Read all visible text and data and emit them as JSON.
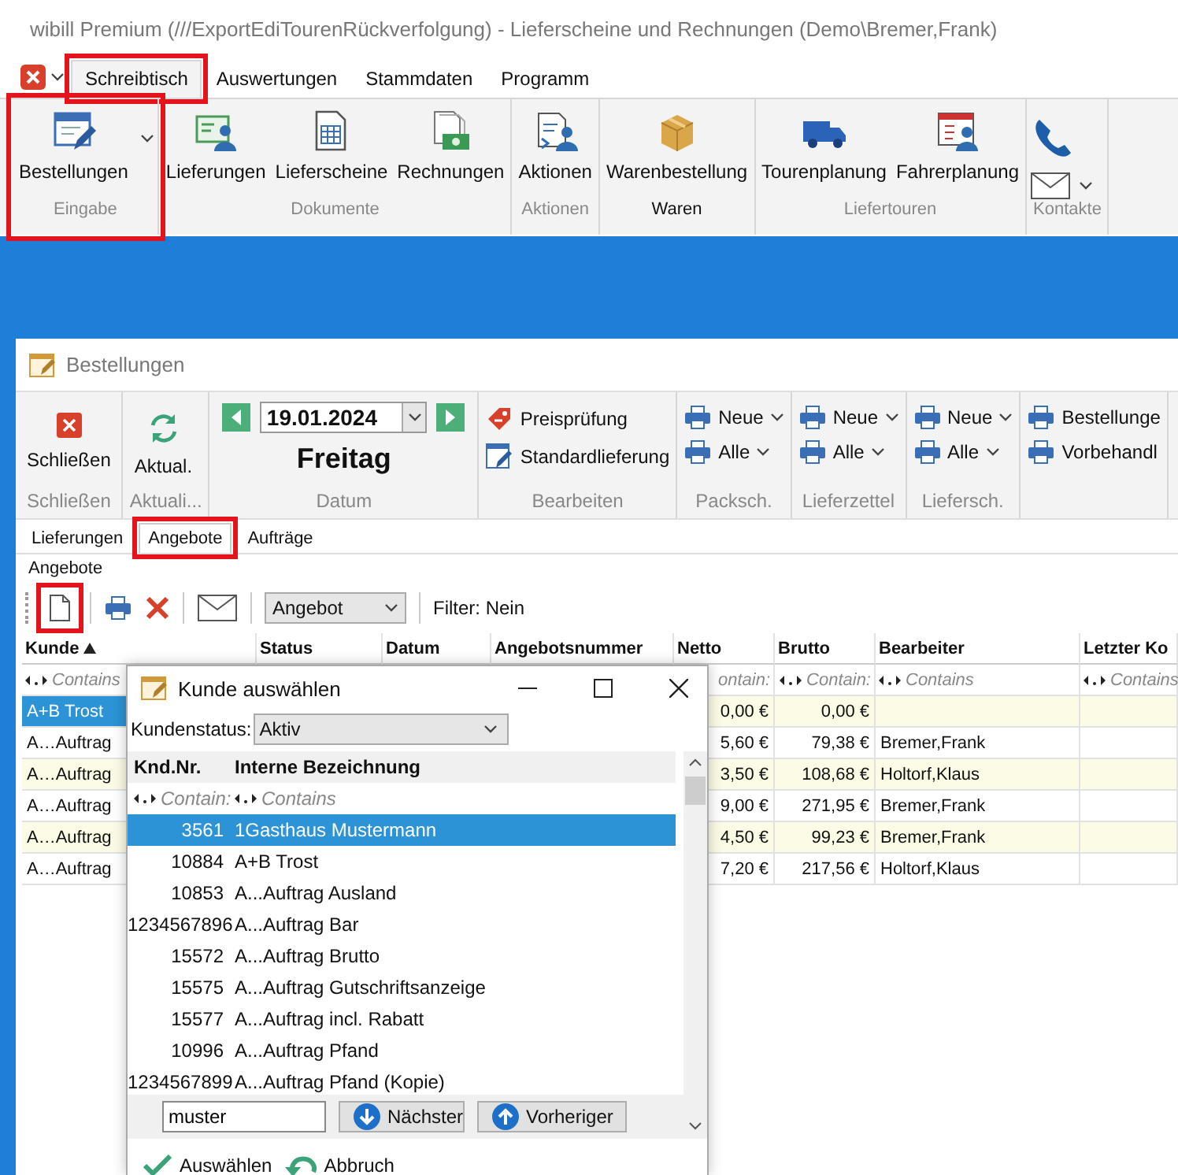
{
  "main_window": {
    "title": "wibill Premium (///ExportEdiTourenRückverfolgung) - Lieferscheine und Rechnungen (Demo\\Bremer,Frank)",
    "menu_tabs": [
      {
        "label": "Schreibtisch",
        "selected": true,
        "highlighted": true
      },
      {
        "label": "Auswertungen",
        "selected": false,
        "highlighted": false
      },
      {
        "label": "Stammdaten",
        "selected": false,
        "highlighted": false
      },
      {
        "label": "Programm",
        "selected": false,
        "highlighted": false
      }
    ],
    "ribbon_groups": [
      {
        "kind": "large",
        "label": "Eingabe",
        "highlighted": true,
        "active": false,
        "buttons": [
          {
            "label": "Bestellungen",
            "dropdown": true
          }
        ]
      },
      {
        "kind": "large",
        "label": "Dokumente",
        "highlighted": false,
        "active": false,
        "buttons": [
          {
            "label": "Lieferungen",
            "dropdown": false
          },
          {
            "label": "Lieferscheine",
            "dropdown": false
          },
          {
            "label": "Rechnungen",
            "dropdown": false
          }
        ]
      },
      {
        "kind": "large",
        "label": "Aktionen",
        "highlighted": false,
        "active": false,
        "buttons": [
          {
            "label": "Aktionen",
            "dropdown": false
          }
        ]
      },
      {
        "kind": "large",
        "label": "Waren",
        "highlighted": false,
        "active": true,
        "buttons": [
          {
            "label": "Warenbestellung",
            "dropdown": false
          }
        ]
      },
      {
        "kind": "large",
        "label": "Liefertouren",
        "highlighted": false,
        "active": false,
        "buttons": [
          {
            "label": "Tourenplanung",
            "dropdown": false
          },
          {
            "label": "Fahrerplanung",
            "dropdown": false
          }
        ]
      },
      {
        "kind": "contacts",
        "label": "Kontakte",
        "highlighted": false,
        "active": false
      }
    ]
  },
  "order_window": {
    "title": "Bestellungen",
    "ribbon_groups": [
      {
        "kind": "large",
        "label": "Schließen",
        "buttons": [
          {
            "label": "Schließen"
          }
        ]
      },
      {
        "kind": "large",
        "label": "Aktuali...",
        "buttons": [
          {
            "label": "Aktual."
          }
        ]
      },
      {
        "kind": "date",
        "label": "Datum",
        "date": "19.01.2024",
        "weekday": "Freitag"
      },
      {
        "kind": "small",
        "label": "Bearbeiten",
        "buttons": [
          {
            "label": "Preisprüfung",
            "dropdown": false
          },
          {
            "label": "Standardlieferung",
            "dropdown": false
          }
        ]
      },
      {
        "kind": "small",
        "label": "Packsch.",
        "buttons": [
          {
            "label": "Neue",
            "dropdown": true
          },
          {
            "label": "Alle",
            "dropdown": true
          }
        ]
      },
      {
        "kind": "small",
        "label": "Lieferzettel",
        "buttons": [
          {
            "label": "Neue",
            "dropdown": true
          },
          {
            "label": "Alle",
            "dropdown": true
          }
        ]
      },
      {
        "kind": "small",
        "label": "Liefersch.",
        "buttons": [
          {
            "label": "Neue",
            "dropdown": true
          },
          {
            "label": "Alle",
            "dropdown": true
          }
        ]
      },
      {
        "kind": "small",
        "buttons": [
          {
            "label": "Bestellunge",
            "dropdown": false
          },
          {
            "label": "Vorbehandl",
            "dropdown": false
          }
        ]
      }
    ],
    "tabs": [
      {
        "label": "Lieferungen",
        "selected": false,
        "highlighted": false
      },
      {
        "label": "Angebote",
        "selected": true,
        "highlighted": true
      },
      {
        "label": "Aufträge",
        "selected": false,
        "highlighted": false
      }
    ],
    "section_label": "Angebote",
    "toolbar": {
      "new_highlighted": true,
      "document_type": "Angebot",
      "filter": "Filter: Nein"
    },
    "grid": {
      "columns": [
        {
          "label": "Kunde",
          "sorted": true
        },
        {
          "label": "Status",
          "sorted": false
        },
        {
          "label": "Datum",
          "sorted": false
        },
        {
          "label": "Angebotsnummer",
          "sorted": false
        },
        {
          "label": "Netto",
          "sorted": false
        },
        {
          "label": "Brutto",
          "sorted": false
        },
        {
          "label": "Bearbeiter",
          "sorted": false
        },
        {
          "label": "Letzter Ko",
          "sorted": false
        }
      ],
      "filter_row": {
        "kunde": {
          "text": "Contains",
          "operator_icon": true
        },
        "netto": {
          "text": "ontain:",
          "operator_icon": false
        },
        "brutto": {
          "text": "Contain:",
          "operator_icon": true
        },
        "bearbeiter": {
          "text": "Contains",
          "operator_icon": true
        },
        "letzter_ko": {
          "text": "Contains",
          "operator_icon": true
        }
      },
      "rows": [
        {
          "kunde": "A+B Trost",
          "netto": "0,00 €",
          "brutto": "0,00 €",
          "selected": true
        },
        {
          "kunde": "A…Auftrag",
          "netto": "5,60 €",
          "brutto": "79,38 €",
          "bearbeiter": "Bremer,Frank",
          "selected": false
        },
        {
          "kunde": "A…Auftrag",
          "netto": "3,50 €",
          "brutto": "108,68 €",
          "bearbeiter": "Holtorf,Klaus",
          "selected": false
        },
        {
          "kunde": "A…Auftrag",
          "netto": "9,00 €",
          "brutto": "271,95 €",
          "bearbeiter": "Bremer,Frank",
          "selected": false
        },
        {
          "kunde": "A…Auftrag",
          "netto": "4,50 €",
          "brutto": "99,23 €",
          "bearbeiter": "Bremer,Frank",
          "selected": false
        },
        {
          "kunde": "A…Auftrag",
          "netto": "7,20 €",
          "brutto": "217,56 €",
          "bearbeiter": "Holtorf,Klaus",
          "selected": false
        }
      ]
    }
  },
  "dialog": {
    "title": "Kunde auswählen",
    "status_label": "Kundenstatus:",
    "status_value": "Aktiv",
    "columns": [
      "Knd.Nr.",
      "Interne Bezeichnung"
    ],
    "filter": [
      "Contain:",
      "Contains"
    ],
    "rows": [
      {
        "number": "3561",
        "name": "1Gasthaus Mustermann",
        "selected": true
      },
      {
        "number": "10884",
        "name": "A+B Trost",
        "selected": false
      },
      {
        "number": "10853",
        "name": "A...Auftrag Ausland",
        "selected": false
      },
      {
        "number": "1234567896",
        "name": "A...Auftrag Bar",
        "selected": false
      },
      {
        "number": "15572",
        "name": "A...Auftrag Brutto",
        "selected": false
      },
      {
        "number": "15575",
        "name": "A...Auftrag Gutschriftsanzeige",
        "selected": false
      },
      {
        "number": "15577",
        "name": "A...Auftrag incl. Rabatt",
        "selected": false
      },
      {
        "number": "10996",
        "name": "A...Auftrag Pfand",
        "selected": false
      },
      {
        "number": "1234567899",
        "name": "A...Auftrag Pfand (Kopie)",
        "selected": false
      }
    ],
    "search_value": "muster",
    "search_buttons": [
      "Nächster",
      "Vorheriger"
    ],
    "actions": [
      "Auswählen",
      "Abbruch"
    ]
  }
}
